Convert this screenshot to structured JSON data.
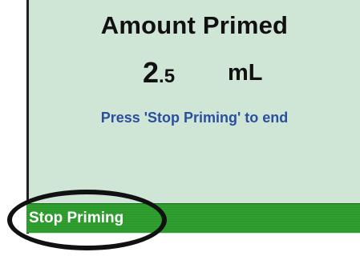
{
  "screen": {
    "title": "Amount Primed",
    "amount": {
      "whole": "2",
      "fraction": ".5",
      "unit": "mL"
    },
    "message": "Press 'Stop Priming' to end"
  },
  "softkeys": {
    "left_label": "Stop Priming"
  },
  "colors": {
    "screen_background": "#cfe5d6",
    "softkey_bar": "#2a9a2a",
    "message_text": "#2b4fa0",
    "highlight_ring": "#111111"
  }
}
